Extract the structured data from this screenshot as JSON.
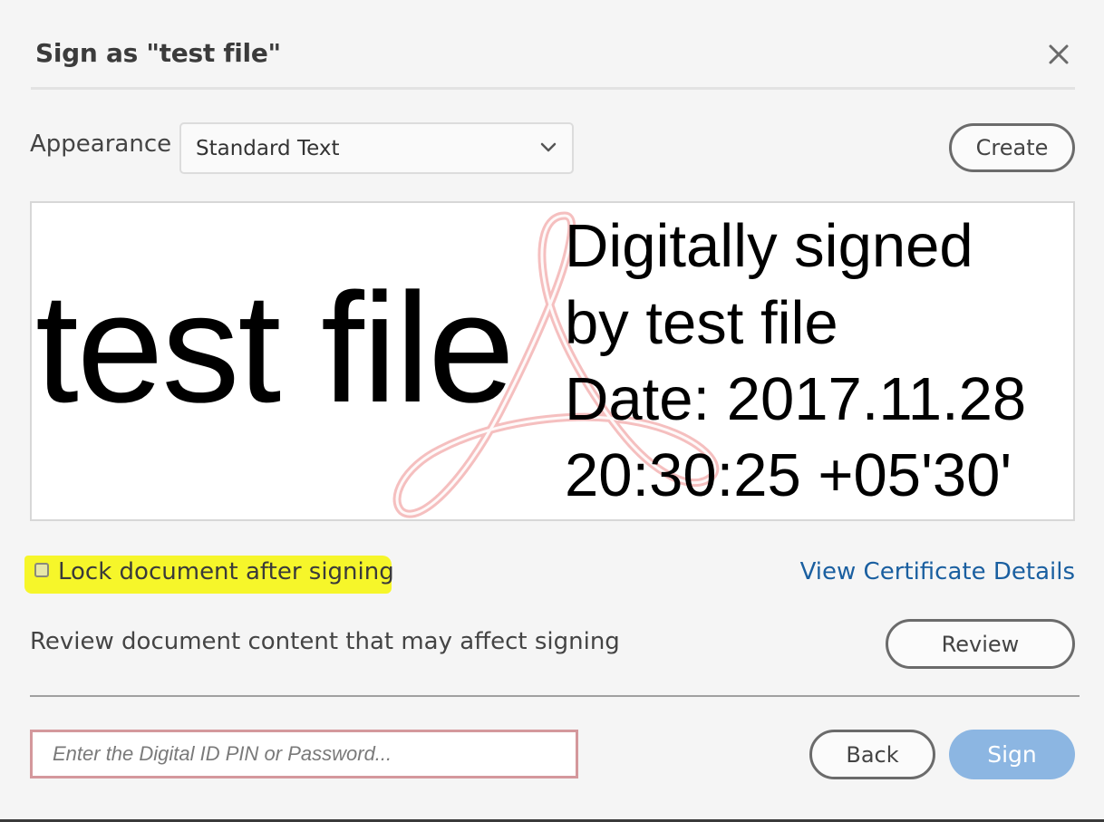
{
  "dialog": {
    "title": "Sign as \"test file\"",
    "close_icon": "close-icon"
  },
  "appearance": {
    "label": "Appearance",
    "selected": "Standard Text",
    "create_label": "Create"
  },
  "preview": {
    "name": "test file",
    "lines": [
      "Digitally signed",
      "by test file",
      "Date: 2017.11.28",
      "20:30:25 +05'30'"
    ],
    "watermark_icon": "acrobat-logo"
  },
  "options": {
    "lock_label": "Lock document after signing",
    "lock_checked": false,
    "highlight_color": "#f6f62a",
    "cert_link": "View Certificate Details"
  },
  "review": {
    "text": "Review document content that may affect signing",
    "button_label": "Review"
  },
  "footer": {
    "pin_placeholder": "Enter the Digital ID PIN or Password...",
    "pin_value": "",
    "back_label": "Back",
    "sign_label": "Sign"
  },
  "colors": {
    "link": "#1a5fa0",
    "sign_button": "#8cb6e2",
    "input_border": "#d4989c"
  }
}
